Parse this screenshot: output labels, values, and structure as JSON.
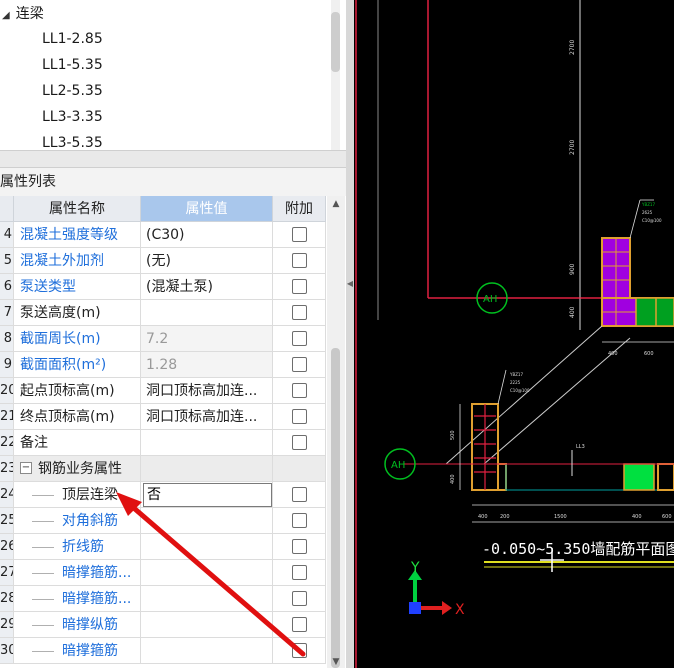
{
  "tree": {
    "group_label": "连梁",
    "items": [
      "LL1-2.85",
      "LL1-5.35",
      "LL2-5.35",
      "LL3-3.35",
      "LL3-5.35"
    ]
  },
  "properties": {
    "panel_title": "属性列表",
    "close_glyph": "×",
    "columns": {
      "name": "属性名称",
      "value": "属性值",
      "add": "附加"
    },
    "rows": [
      {
        "num": "4",
        "name": "混凝土强度等级",
        "value": "(C30)",
        "style": "blue"
      },
      {
        "num": "5",
        "name": "混凝土外加剂",
        "value": "(无)",
        "style": "blue"
      },
      {
        "num": "6",
        "name": "泵送类型",
        "value": "(混凝土泵)",
        "style": "blue"
      },
      {
        "num": "7",
        "name": "泵送高度(m)",
        "value": "",
        "style": "dark"
      },
      {
        "num": "8",
        "name": "截面周长(m)",
        "value": "7.2",
        "style": "blue",
        "grey": true
      },
      {
        "num": "9",
        "name": "截面面积(m²)",
        "value": "1.28",
        "style": "blue",
        "grey": true
      },
      {
        "num": "20",
        "name": "起点顶标高(m)",
        "value": "洞口顶标高加连...",
        "style": "dark"
      },
      {
        "num": "21",
        "name": "终点顶标高(m)",
        "value": "洞口顶标高加连...",
        "style": "dark"
      },
      {
        "num": "22",
        "name": "备注",
        "value": "",
        "style": "dark"
      },
      {
        "num": "23",
        "name": "钢筋业务属性",
        "value": "",
        "style": "group",
        "expander": "−"
      },
      {
        "num": "24",
        "name": "顶层连梁",
        "value": "否",
        "style": "child-dark",
        "editing": true
      },
      {
        "num": "25",
        "name": "对角斜筋",
        "value": "",
        "style": "child-blue"
      },
      {
        "num": "26",
        "name": "折线筋",
        "value": "",
        "style": "child-blue"
      },
      {
        "num": "27",
        "name": "暗撑箍筋...",
        "value": "",
        "style": "child-blue"
      },
      {
        "num": "28",
        "name": "暗撑箍筋...",
        "value": "",
        "style": "child-blue"
      },
      {
        "num": "29",
        "name": "暗撑纵筋",
        "value": "",
        "style": "child-blue"
      },
      {
        "num": "30",
        "name": "暗撑箍筋",
        "value": "",
        "style": "child-blue"
      }
    ]
  },
  "cad": {
    "axis_labels": [
      "AH",
      "AH"
    ],
    "drawing_title": "-0.050~5.350墙配筋平面图",
    "axis_x": "X",
    "axis_y": "Y",
    "dim_texts": {
      "d_2700": "2700",
      "d_900": "900",
      "d_400a": "400",
      "d_200a": "200",
      "d_400b": "400",
      "d_600": "600",
      "d_500": "500",
      "d_400c": "400",
      "d_400d": "400",
      "d_200b": "200",
      "d_1500": "1500",
      "d_400e": "400",
      "d_600b": "600",
      "d_top": "2700",
      "d_ll3": "LL3"
    },
    "labels": {
      "tag1": "YBZ17",
      "tag1b": "2625",
      "tag1c": "C10@100",
      "tag2": "YBZ17",
      "tag2b": "2225",
      "tag2c": "C10@100"
    },
    "colors": {
      "background": "#000000",
      "wall": "#e0a030",
      "purple": "#a000e0",
      "green": "#00c020",
      "red": "#e02040",
      "accent_arrow": "#e01010"
    }
  }
}
